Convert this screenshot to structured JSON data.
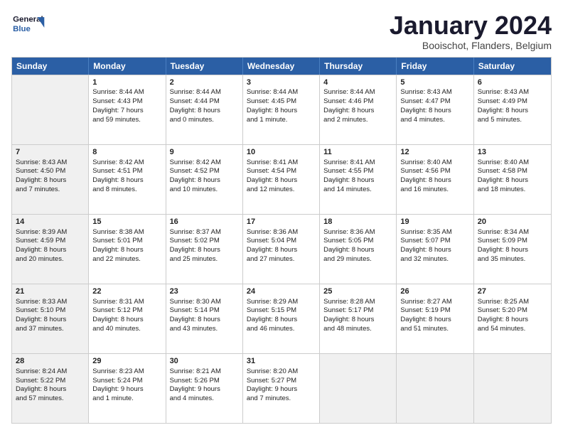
{
  "header": {
    "logo_line1": "General",
    "logo_line2": "Blue",
    "month": "January 2024",
    "location": "Booischot, Flanders, Belgium"
  },
  "days_of_week": [
    "Sunday",
    "Monday",
    "Tuesday",
    "Wednesday",
    "Thursday",
    "Friday",
    "Saturday"
  ],
  "weeks": [
    [
      {
        "day": "",
        "info": "",
        "shaded": true
      },
      {
        "day": "1",
        "info": "Sunrise: 8:44 AM\nSunset: 4:43 PM\nDaylight: 7 hours\nand 59 minutes.",
        "shaded": false
      },
      {
        "day": "2",
        "info": "Sunrise: 8:44 AM\nSunset: 4:44 PM\nDaylight: 8 hours\nand 0 minutes.",
        "shaded": false
      },
      {
        "day": "3",
        "info": "Sunrise: 8:44 AM\nSunset: 4:45 PM\nDaylight: 8 hours\nand 1 minute.",
        "shaded": false
      },
      {
        "day": "4",
        "info": "Sunrise: 8:44 AM\nSunset: 4:46 PM\nDaylight: 8 hours\nand 2 minutes.",
        "shaded": false
      },
      {
        "day": "5",
        "info": "Sunrise: 8:43 AM\nSunset: 4:47 PM\nDaylight: 8 hours\nand 4 minutes.",
        "shaded": false
      },
      {
        "day": "6",
        "info": "Sunrise: 8:43 AM\nSunset: 4:49 PM\nDaylight: 8 hours\nand 5 minutes.",
        "shaded": false
      }
    ],
    [
      {
        "day": "7",
        "info": "Sunrise: 8:43 AM\nSunset: 4:50 PM\nDaylight: 8 hours\nand 7 minutes.",
        "shaded": true
      },
      {
        "day": "8",
        "info": "Sunrise: 8:42 AM\nSunset: 4:51 PM\nDaylight: 8 hours\nand 8 minutes.",
        "shaded": false
      },
      {
        "day": "9",
        "info": "Sunrise: 8:42 AM\nSunset: 4:52 PM\nDaylight: 8 hours\nand 10 minutes.",
        "shaded": false
      },
      {
        "day": "10",
        "info": "Sunrise: 8:41 AM\nSunset: 4:54 PM\nDaylight: 8 hours\nand 12 minutes.",
        "shaded": false
      },
      {
        "day": "11",
        "info": "Sunrise: 8:41 AM\nSunset: 4:55 PM\nDaylight: 8 hours\nand 14 minutes.",
        "shaded": false
      },
      {
        "day": "12",
        "info": "Sunrise: 8:40 AM\nSunset: 4:56 PM\nDaylight: 8 hours\nand 16 minutes.",
        "shaded": false
      },
      {
        "day": "13",
        "info": "Sunrise: 8:40 AM\nSunset: 4:58 PM\nDaylight: 8 hours\nand 18 minutes.",
        "shaded": false
      }
    ],
    [
      {
        "day": "14",
        "info": "Sunrise: 8:39 AM\nSunset: 4:59 PM\nDaylight: 8 hours\nand 20 minutes.",
        "shaded": true
      },
      {
        "day": "15",
        "info": "Sunrise: 8:38 AM\nSunset: 5:01 PM\nDaylight: 8 hours\nand 22 minutes.",
        "shaded": false
      },
      {
        "day": "16",
        "info": "Sunrise: 8:37 AM\nSunset: 5:02 PM\nDaylight: 8 hours\nand 25 minutes.",
        "shaded": false
      },
      {
        "day": "17",
        "info": "Sunrise: 8:36 AM\nSunset: 5:04 PM\nDaylight: 8 hours\nand 27 minutes.",
        "shaded": false
      },
      {
        "day": "18",
        "info": "Sunrise: 8:36 AM\nSunset: 5:05 PM\nDaylight: 8 hours\nand 29 minutes.",
        "shaded": false
      },
      {
        "day": "19",
        "info": "Sunrise: 8:35 AM\nSunset: 5:07 PM\nDaylight: 8 hours\nand 32 minutes.",
        "shaded": false
      },
      {
        "day": "20",
        "info": "Sunrise: 8:34 AM\nSunset: 5:09 PM\nDaylight: 8 hours\nand 35 minutes.",
        "shaded": false
      }
    ],
    [
      {
        "day": "21",
        "info": "Sunrise: 8:33 AM\nSunset: 5:10 PM\nDaylight: 8 hours\nand 37 minutes.",
        "shaded": true
      },
      {
        "day": "22",
        "info": "Sunrise: 8:31 AM\nSunset: 5:12 PM\nDaylight: 8 hours\nand 40 minutes.",
        "shaded": false
      },
      {
        "day": "23",
        "info": "Sunrise: 8:30 AM\nSunset: 5:14 PM\nDaylight: 8 hours\nand 43 minutes.",
        "shaded": false
      },
      {
        "day": "24",
        "info": "Sunrise: 8:29 AM\nSunset: 5:15 PM\nDaylight: 8 hours\nand 46 minutes.",
        "shaded": false
      },
      {
        "day": "25",
        "info": "Sunrise: 8:28 AM\nSunset: 5:17 PM\nDaylight: 8 hours\nand 48 minutes.",
        "shaded": false
      },
      {
        "day": "26",
        "info": "Sunrise: 8:27 AM\nSunset: 5:19 PM\nDaylight: 8 hours\nand 51 minutes.",
        "shaded": false
      },
      {
        "day": "27",
        "info": "Sunrise: 8:25 AM\nSunset: 5:20 PM\nDaylight: 8 hours\nand 54 minutes.",
        "shaded": false
      }
    ],
    [
      {
        "day": "28",
        "info": "Sunrise: 8:24 AM\nSunset: 5:22 PM\nDaylight: 8 hours\nand 57 minutes.",
        "shaded": true
      },
      {
        "day": "29",
        "info": "Sunrise: 8:23 AM\nSunset: 5:24 PM\nDaylight: 9 hours\nand 1 minute.",
        "shaded": false
      },
      {
        "day": "30",
        "info": "Sunrise: 8:21 AM\nSunset: 5:26 PM\nDaylight: 9 hours\nand 4 minutes.",
        "shaded": false
      },
      {
        "day": "31",
        "info": "Sunrise: 8:20 AM\nSunset: 5:27 PM\nDaylight: 9 hours\nand 7 minutes.",
        "shaded": false
      },
      {
        "day": "",
        "info": "",
        "shaded": true
      },
      {
        "day": "",
        "info": "",
        "shaded": true
      },
      {
        "day": "",
        "info": "",
        "shaded": true
      }
    ]
  ]
}
